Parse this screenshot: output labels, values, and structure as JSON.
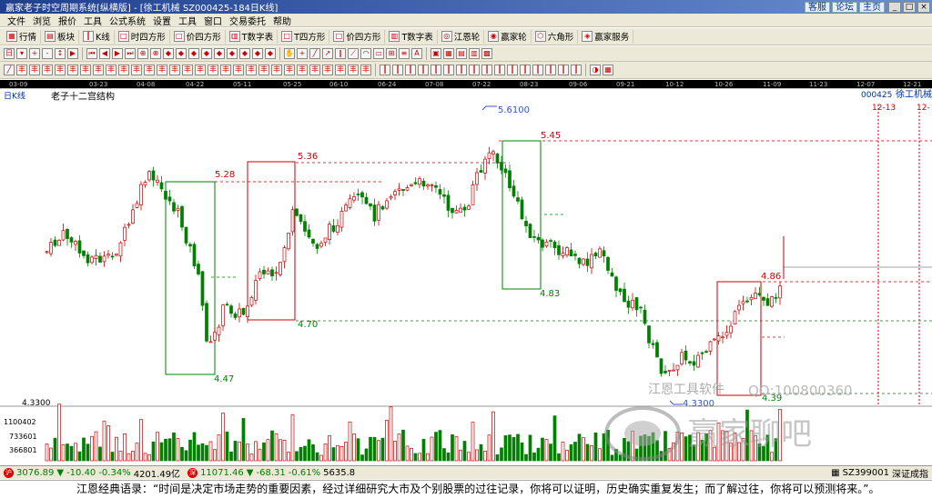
{
  "window": {
    "title": "赢家老子时空周期系统[纵横版] - [徐工机械  SZ000425-184日K线]",
    "links": [
      "客服",
      "论坛",
      "主页"
    ],
    "controls": [
      "_",
      "□",
      "×"
    ]
  },
  "menu": [
    "文件",
    "浏览",
    "报价",
    "工具",
    "公式系统",
    "设置",
    "工具",
    "窗口",
    "交易委托",
    "帮助"
  ],
  "toolbar1": [
    {
      "label": "行情",
      "icon": "grid-icon"
    },
    {
      "label": "板块",
      "icon": "blocks-icon"
    },
    {
      "label": "K线",
      "icon": "candle-icon"
    },
    {
      "label": "时四方形",
      "icon": "square-icon"
    },
    {
      "label": "价四方形",
      "icon": "square-icon"
    },
    {
      "label": "T数字表",
      "icon": "table-icon"
    },
    {
      "label": "T四方形",
      "icon": "square-icon"
    },
    {
      "label": "价四方形",
      "icon": "square-icon"
    },
    {
      "label": "T数字表",
      "icon": "table-icon"
    },
    {
      "label": "江恩轮",
      "icon": "wheel-icon"
    },
    {
      "label": "赢家轮",
      "icon": "wheel-icon"
    },
    {
      "label": "六角形",
      "icon": "hexagon-icon"
    },
    {
      "label": "赢家服务",
      "icon": "service-icon"
    }
  ],
  "date_axis": [
    "03-09",
    "03-23",
    "04-08",
    "04-22",
    "05-11",
    "05-25",
    "06-10",
    "06-24",
    "07-08",
    "07-22",
    "08-23",
    "09-06",
    "09-21",
    "10-12",
    "10-26",
    "11-09",
    "11-23",
    "12-07",
    "12-21"
  ],
  "chart": {
    "period_label": "日K线",
    "indicator_label": "老子十二宫结构",
    "stock_code": "000425",
    "stock_name": "徐工机械",
    "date_markers": [
      "12-13",
      "12-"
    ],
    "price_low_label": "4.3300",
    "volume_ticks": [
      "1100402",
      "733601",
      "366801"
    ],
    "annotations": {
      "high": "5.6100",
      "low": "4.3300",
      "box1_top": "5.28",
      "box1_bottom": "4.47",
      "box2_top": "5.36",
      "box2_bottom": "4.70",
      "box3_top": "5.45",
      "box3_bottom": "4.83",
      "box4_top": "4.86",
      "box4_bottom": "4.39"
    },
    "watermark_software": "江恩工具软件",
    "watermark_qq": "QQ:100800360",
    "watermark_brand": "赢家聊吧",
    "colors": {
      "up": "#cc0000",
      "down": "#008000",
      "box_red": "#cc0000",
      "box_green": "#008000",
      "bg": "#ffffff"
    }
  },
  "chart_data": {
    "type": "candlestick",
    "x": [
      "03-09",
      "03-23",
      "04-08",
      "04-22",
      "05-11",
      "05-25",
      "06-10",
      "06-24",
      "07-08",
      "07-22",
      "08-23",
      "09-06",
      "09-21",
      "10-12",
      "10-26",
      "11-09",
      "11-23",
      "12-07",
      "12-21"
    ],
    "close_approx": [
      4.95,
      4.85,
      5.2,
      4.6,
      4.75,
      5.1,
      5.05,
      5.2,
      5.15,
      5.4,
      4.95,
      4.95,
      4.7,
      4.35,
      4.55,
      4.75,
      4.8,
      4.85,
      4.9
    ],
    "price_levels": [
      5.61,
      5.45,
      5.36,
      5.28,
      4.86,
      4.83,
      4.7,
      4.47,
      4.39,
      4.33
    ],
    "volume_ticks": [
      1100402,
      733601,
      366801
    ]
  },
  "ticker": [
    {
      "name": "沪",
      "value": "3076.89",
      "change": "-10.40",
      "pct": "-0.34%",
      "vol": "4201.49亿"
    },
    {
      "name": "深",
      "value": "11071.46",
      "change": "-68.31",
      "pct": "-0.61%",
      "vol": "5635.8"
    },
    {
      "name": "深证成指",
      "value": "SZ399001"
    }
  ],
  "quote": "江恩经典语录：“时间是决定市场走势的重要因素，经过详细研究大市及个别股票的过往记录，你将可以证明，历史确实重复发生；而了解过往，你将可以预测将来。”。"
}
